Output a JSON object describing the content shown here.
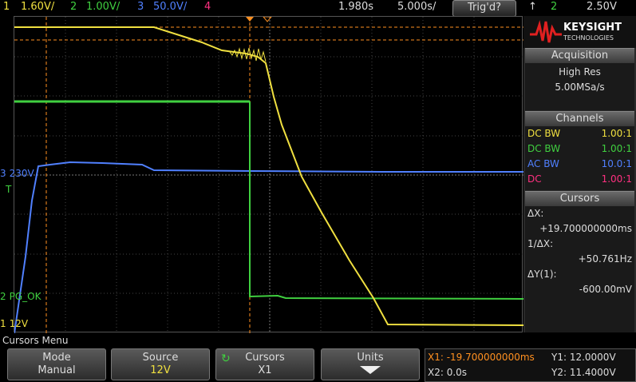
{
  "topbar": {
    "ch1": {
      "num": "1",
      "val": "1.60V/",
      "color": "#f0e040"
    },
    "ch2": {
      "num": "2",
      "val": "1.00V/",
      "color": "#40d040"
    },
    "ch3": {
      "num": "3",
      "val": "50.0V/",
      "color": "#5080ff"
    },
    "ch4": {
      "num": "4",
      "color": "#ff3080"
    },
    "delay": "1.980s",
    "timebase": "5.000s/",
    "trig_button": "Trig'd?",
    "trig_icon": "trigger-edge-icon",
    "trig_ch": "2",
    "trig_level": "2.50V"
  },
  "logo": {
    "brand": "KEYSIGHT",
    "sub": "TECHNOLOGIES"
  },
  "acquisition": {
    "title": "Acquisition",
    "mode": "High Res",
    "rate": "5.00MSa/s"
  },
  "channels": {
    "title": "Channels",
    "rows": [
      {
        "coupling": "DC BW",
        "ratio": "1.00:1",
        "color": "#f0e040"
      },
      {
        "coupling": "DC BW",
        "ratio": "1.00:1",
        "color": "#40d040"
      },
      {
        "coupling": "AC BW",
        "ratio": "10.0:1",
        "color": "#5080ff"
      },
      {
        "coupling": "DC",
        "ratio": "1.00:1",
        "color": "#ff3080"
      }
    ]
  },
  "cursors_panel": {
    "title": "Cursors",
    "dx_label": "ΔX:",
    "dx_value": "+19.700000000ms",
    "inv_dx_label": "1/ΔX:",
    "inv_dx_value": "+50.761Hz",
    "dy_label": "ΔY(1):",
    "dy_value": "-600.00mV"
  },
  "markers": {
    "ch3": {
      "num": "3",
      "label": "230V"
    },
    "trig": {
      "label": "T"
    },
    "ch2": {
      "num": "2",
      "label": "PG_OK"
    },
    "ch1": {
      "num": "1",
      "label": "12V"
    }
  },
  "menu": {
    "title": "Cursors Menu",
    "keys": [
      {
        "top": "Mode",
        "bottom": "Manual",
        "bottom_color": "#ddd"
      },
      {
        "top": "Source",
        "bottom": "12V",
        "bottom_color": "#f0e040"
      },
      {
        "top": "Cursors",
        "bottom": "X1",
        "bottom_color": "#ddd"
      },
      {
        "top": "Units",
        "bottom": "",
        "bottom_color": "#ddd"
      }
    ]
  },
  "readout": {
    "x1": "X1: -19.700000000ms",
    "x2": "X2: 0.0s",
    "y1": "Y1: 12.0000V",
    "y2": "Y2: 11.4000V"
  }
}
